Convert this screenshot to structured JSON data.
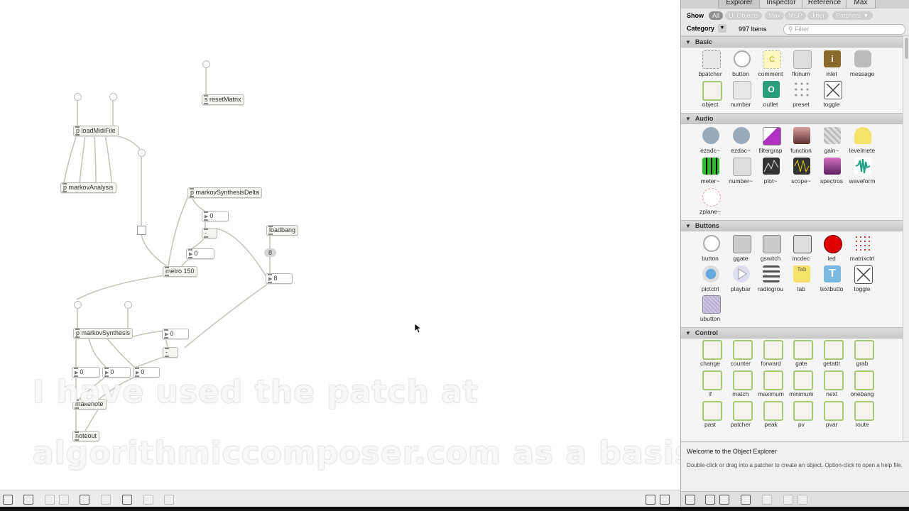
{
  "patcher": {
    "objects": {
      "reset_matrix": "s resetMatrix",
      "load_midi_file": "p loadMidiFile",
      "markov_analysis": "p markovAnalysis",
      "markov_synthesis_delta": "p markovSynthesisDelta",
      "loadbang": "loadbang",
      "metro": "metro 150",
      "markov_synthesis": "p markovSynthesis",
      "makenote": "makenote",
      "noteout": "noteout",
      "minus1": "-",
      "minus2": "-"
    },
    "numbers": {
      "n1": "0",
      "n2": "0",
      "n3": "8",
      "n4": "0",
      "n5": "0",
      "n6": "0",
      "n7": "0"
    },
    "message_value": "8"
  },
  "caption": {
    "line1": "I have used the patch at",
    "line2": "algorithmiccomposer.com as a basis..."
  },
  "explorer": {
    "tabs": [
      "Explorer",
      "Inspector",
      "Reference",
      "Max"
    ],
    "show_label": "Show",
    "filters": [
      "All",
      "UI Objects",
      "Max",
      "MSP",
      "Jitter",
      "Patchers ▼"
    ],
    "category_label": "Category",
    "item_count": "997 Items",
    "filter_placeholder": "Filter",
    "sections": {
      "basic": {
        "title": "Basic",
        "items": [
          "bpatcher",
          "button",
          "comment",
          "flonum",
          "inlet",
          "message",
          "object",
          "number",
          "outlet",
          "preset",
          "toggle"
        ]
      },
      "audio": {
        "title": "Audio",
        "items": [
          "ezadc~",
          "ezdac~",
          "filtergrap",
          "function",
          "gain~",
          "levelmete",
          "meter~",
          "number~",
          "plot~",
          "scope~",
          "spectros",
          "waveform",
          "zplane~"
        ]
      },
      "buttons": {
        "title": "Buttons",
        "items": [
          "button",
          "ggate",
          "gswitch",
          "incdec",
          "led",
          "matrixctrl",
          "pictctrl",
          "playbar",
          "radiogrou",
          "tab",
          "textbutto",
          "toggle",
          "ubutton"
        ]
      },
      "control": {
        "title": "Control",
        "items": [
          "change",
          "counter",
          "forward",
          "gate",
          "getattr",
          "grab",
          "if",
          "match",
          "maximum",
          "minimum",
          "next",
          "onebang",
          "past",
          "patcher",
          "peak",
          "pv",
          "pvar",
          "route"
        ]
      }
    },
    "welcome_title": "Welcome to the Object Explorer",
    "welcome_body": "Double-click or drag into a patcher to create an object. Option-click to open a help file.",
    "comment_glyph": "C",
    "inlet_glyph": "i",
    "outlet_glyph": "O",
    "tab_glyph": "Tab",
    "textbutton_glyph": "T"
  },
  "colors": {
    "accent_green": "#2a9d7a",
    "led_red": "#e00000",
    "meter_green": "#2db82d"
  }
}
